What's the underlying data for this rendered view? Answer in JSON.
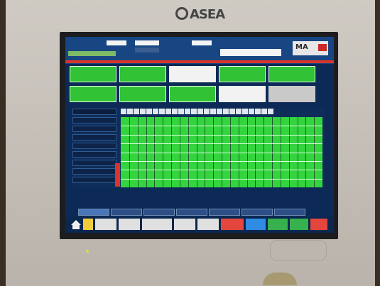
{
  "brand": "ASEA",
  "header": {
    "left_small_1": "",
    "left_small_2": "",
    "field_1": "",
    "field_2": "",
    "field_3": "",
    "field_4": "",
    "label_mid": "",
    "mode_text": "",
    "brandbox_text": "MA",
    "status_text": ""
  },
  "buttons": {
    "row1": [
      "",
      "",
      "",
      "",
      ""
    ],
    "row2": [
      "",
      "",
      "",
      "",
      ""
    ]
  },
  "grid": {
    "row_labels": [
      "",
      "",
      "",
      "",
      "",
      "",
      "",
      "",
      ""
    ],
    "column_headers": [
      "",
      "",
      "",
      "",
      "",
      "",
      "",
      "",
      "",
      "",
      "",
      "",
      "",
      "",
      "",
      "",
      "",
      "",
      "",
      "",
      "",
      "",
      "",
      ""
    ]
  },
  "tabs": [
    "",
    "",
    "",
    "",
    "",
    "",
    "",
    ""
  ],
  "toolbar": [
    "",
    "",
    "",
    "",
    "",
    "",
    "",
    "",
    "",
    "",
    ""
  ],
  "colors": {
    "screen_bg": "#0c2a55",
    "green": "#34d43f",
    "red": "#d8352a",
    "header_blue": "#174683"
  }
}
